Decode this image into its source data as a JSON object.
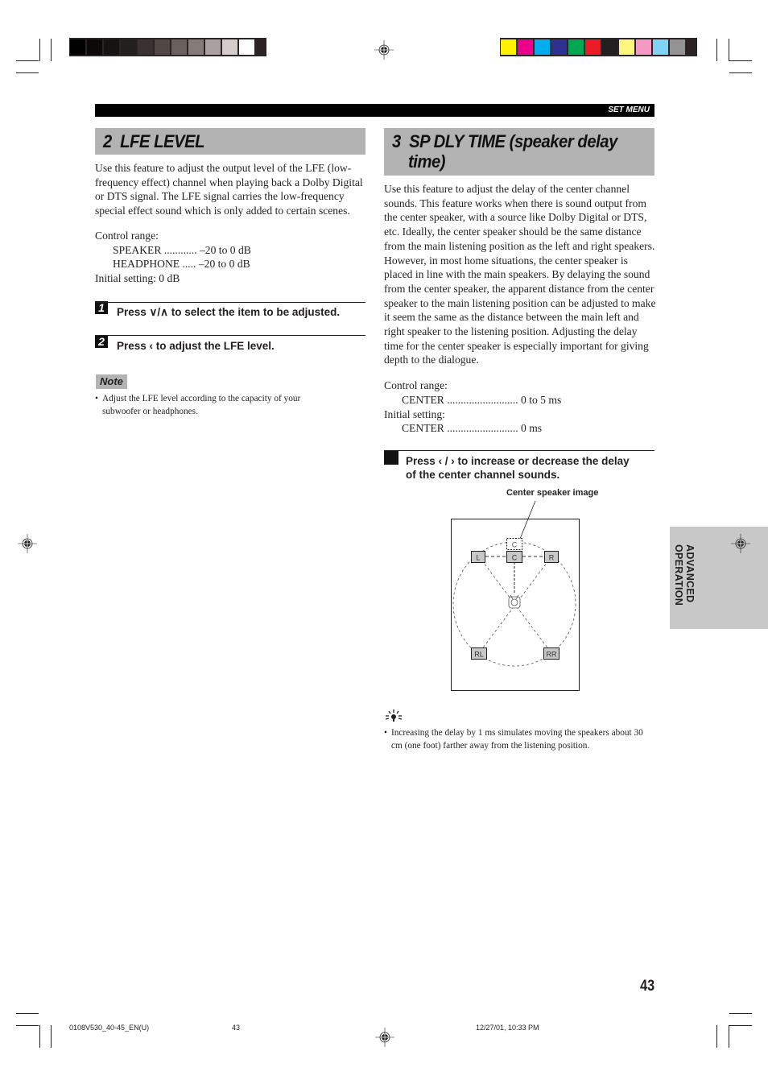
{
  "print_marks": {
    "grayscale_swatches": [
      "#000000",
      "#0c0a09",
      "#161312",
      "#231f1d",
      "#3a3230",
      "#514745",
      "#6b605e",
      "#857b79",
      "#a9a09f",
      "#d3cccb",
      "#ffffff"
    ],
    "color_swatches": [
      "#fff200",
      "#ec008c",
      "#00aeef",
      "#2e3192",
      "#00a651",
      "#ed1c24",
      "#231f20",
      "#fff57d",
      "#f49ac2",
      "#7dd4f7",
      "#939393"
    ]
  },
  "header": {
    "section_label": "SET MENU"
  },
  "left_section": {
    "title": "2  LFE LEVEL",
    "intro": "Use this feature to adjust the output level of the LFE (low-frequency effect) channel when playing back a Dolby Digital or DTS signal. The LFE signal carries the low-frequency special effect sound which is only added to certain scenes.",
    "control_range_label": "Control range:",
    "ranges": [
      {
        "text": "SPEAKER ............ –20 to 0 dB"
      },
      {
        "text": "HEADPHONE ..... –20 to 0 dB"
      }
    ],
    "initial_setting": "Initial setting: 0 dB",
    "steps": [
      {
        "num": "1",
        "text": "Press ∨/∧ to select the item to be adjusted."
      },
      {
        "num": "2",
        "text": "Press ‹ to adjust the LFE level."
      }
    ],
    "note_label": "Note",
    "note": "Adjust the LFE level according to the capacity of your subwoofer or headphones."
  },
  "right_section": {
    "title_line1": "3  SP DLY TIME (speaker delay",
    "title_line2": "time)",
    "intro": "Use this feature to adjust the delay of the center channel sounds. This feature works when there is sound output from the center speaker, with a source like Dolby Digital or DTS, etc. Ideally, the center speaker should be the same distance from the main listening position as the left and right speakers. However, in most home situations, the center speaker is placed in line with the main speakers. By delaying the sound from the center speaker, the apparent distance from the center speaker to the main listening position can be adjusted to make it seem the same as the distance between the main left and right speaker to the listening position. Adjusting the delay time for the center speaker is especially important for giving depth to the dialogue.",
    "control_range_label": "Control range:",
    "control_range": "CENTER .......................... 0 to 5 ms",
    "initial_setting_label": "Initial setting:",
    "initial_setting": "CENTER .......................... 0 ms",
    "step_text_line1": "Press ‹ / › to increase or decrease the delay",
    "step_text_line2": "of the center channel sounds.",
    "diagram": {
      "caption": "Center speaker image",
      "speakers": {
        "center_image": "C",
        "left": "L",
        "center": "C",
        "right": "R",
        "rear_left": "RL",
        "rear_right": "RR"
      }
    },
    "tip_icon": "lightbulb-tip-icon",
    "tip": "Increasing the delay by 1 ms simulates moving the speakers about 30 cm (one foot) farther away from the listening position."
  },
  "side_tab": {
    "line1": "ADVANCED",
    "line2": "OPERATION"
  },
  "page_number": "43",
  "footer": {
    "file": "0108V530_40-45_EN(U)",
    "page": "43",
    "timestamp": "12/27/01, 10:33 PM"
  }
}
